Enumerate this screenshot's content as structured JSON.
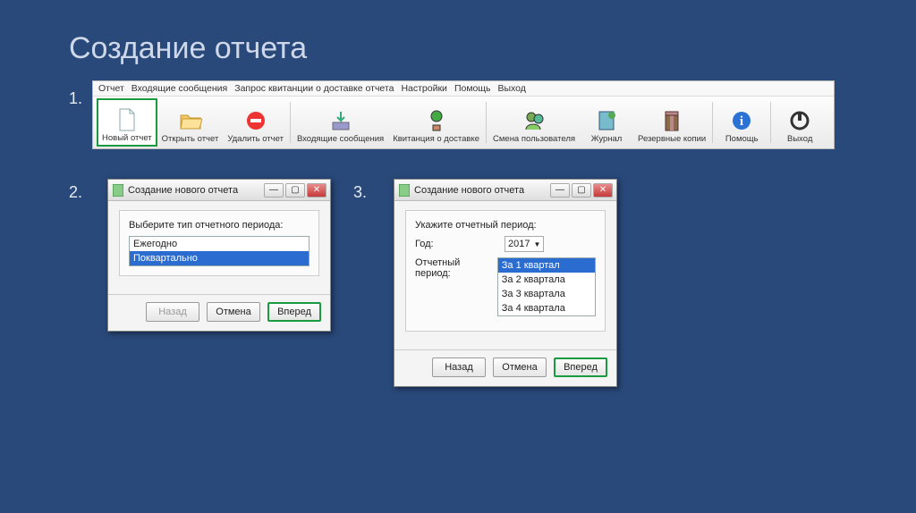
{
  "slide": {
    "title": "Создание отчета"
  },
  "steps": {
    "one": "1.",
    "two": "2.",
    "three": "3."
  },
  "menu": {
    "items": [
      "Отчет",
      "Входящие сообщения",
      "Запрос квитанции о доставке отчета",
      "Настройки",
      "Помощь",
      "Выход"
    ]
  },
  "toolbar": {
    "new_report": "Новый отчет",
    "open_report": "Открыть отчет",
    "delete_report": "Удалить отчет",
    "inbox": "Входящие сообщения",
    "receipt": "Квитанция о доставке",
    "switch_user": "Смена пользователя",
    "journal": "Журнал",
    "backup": "Резервные копии",
    "help": "Помощь",
    "exit": "Выход"
  },
  "dialog2": {
    "title": "Создание нового отчета",
    "prompt": "Выберите тип отчетного периода:",
    "options": [
      "Ежегодно",
      "Поквартально"
    ],
    "back": "Назад",
    "cancel": "Отмена",
    "next": "Вперед"
  },
  "dialog3": {
    "title": "Создание нового отчета",
    "prompt": "Укажите отчетный период:",
    "year_label": "Год:",
    "year_value": "2017",
    "period_label": "Отчетный период:",
    "period_selected": "За 1 квартал",
    "period_options": [
      "За 1 квартал",
      "За 2 квартала",
      "За 3 квартала",
      "За 4 квартала"
    ],
    "back": "Назад",
    "cancel": "Отмена",
    "next": "Вперед"
  },
  "win": {
    "min": "—",
    "max": "▢",
    "close": "✕"
  }
}
